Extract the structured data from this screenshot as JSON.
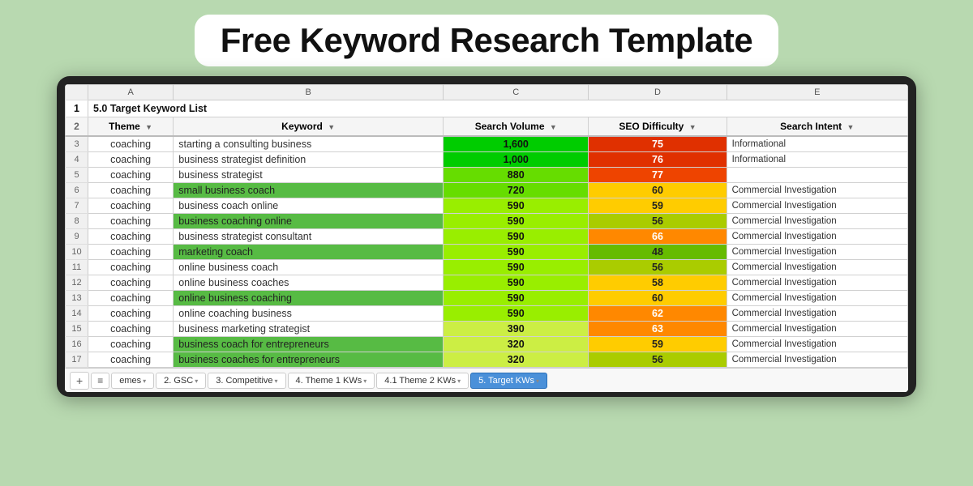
{
  "title": "Free Keyword Research Template",
  "spreadsheet": {
    "section_title": "5.0 Target Keyword List",
    "columns": {
      "letters": [
        "",
        "A",
        "B",
        "C",
        "D",
        "E"
      ],
      "headers": [
        "",
        "Theme",
        "Keyword",
        "Search Volume",
        "SEO Difficulty",
        "Search Intent"
      ]
    },
    "rows": [
      {
        "num": 3,
        "theme": "coaching",
        "keyword": "starting a consulting business",
        "keyword_green": false,
        "volume": "1,600",
        "vol_class": "green-bright",
        "seo": 75,
        "seo_class": "red-dark",
        "intent": "Informational"
      },
      {
        "num": 4,
        "theme": "coaching",
        "keyword": "business strategist definition",
        "keyword_green": false,
        "volume": "1,000",
        "vol_class": "green-bright",
        "seo": 76,
        "seo_class": "red-dark",
        "intent": "Informational"
      },
      {
        "num": 5,
        "theme": "coaching",
        "keyword": "business strategist",
        "keyword_green": false,
        "volume": "880",
        "vol_class": "green-med",
        "seo": 77,
        "seo_class": "red-med",
        "intent": ""
      },
      {
        "num": 6,
        "theme": "coaching",
        "keyword": "small business coach",
        "keyword_green": true,
        "volume": "720",
        "vol_class": "green-med",
        "seo": 60,
        "seo_class": "yellow",
        "intent": "Commercial Investigation"
      },
      {
        "num": 7,
        "theme": "coaching",
        "keyword": "business coach online",
        "keyword_green": false,
        "volume": "590",
        "vol_class": "green-light",
        "seo": 59,
        "seo_class": "yellow",
        "intent": "Commercial Investigation"
      },
      {
        "num": 8,
        "theme": "coaching",
        "keyword": "business coaching online",
        "keyword_green": true,
        "volume": "590",
        "vol_class": "green-light",
        "seo": 56,
        "seo_class": "yellow-green",
        "intent": "Commercial Investigation"
      },
      {
        "num": 9,
        "theme": "coaching",
        "keyword": "business strategist consultant",
        "keyword_green": false,
        "volume": "590",
        "vol_class": "green-light",
        "seo": 66,
        "seo_class": "orange",
        "intent": "Commercial Investigation"
      },
      {
        "num": 10,
        "theme": "coaching",
        "keyword": "marketing coach",
        "keyword_green": true,
        "volume": "590",
        "vol_class": "green-light",
        "seo": 48,
        "seo_class": "green",
        "intent": "Commercial Investigation"
      },
      {
        "num": 11,
        "theme": "coaching",
        "keyword": "online business coach",
        "keyword_green": false,
        "volume": "590",
        "vol_class": "green-light",
        "seo": 56,
        "seo_class": "yellow-green",
        "intent": "Commercial Investigation"
      },
      {
        "num": 12,
        "theme": "coaching",
        "keyword": "online business coaches",
        "keyword_green": false,
        "volume": "590",
        "vol_class": "green-light",
        "seo": 58,
        "seo_class": "yellow",
        "intent": "Commercial Investigation"
      },
      {
        "num": 13,
        "theme": "coaching",
        "keyword": "online business coaching",
        "keyword_green": true,
        "volume": "590",
        "vol_class": "green-light",
        "seo": 60,
        "seo_class": "yellow",
        "intent": "Commercial Investigation"
      },
      {
        "num": 14,
        "theme": "coaching",
        "keyword": "online coaching business",
        "keyword_green": false,
        "volume": "590",
        "vol_class": "green-light",
        "seo": 62,
        "seo_class": "orange",
        "intent": "Commercial Investigation"
      },
      {
        "num": 15,
        "theme": "coaching",
        "keyword": "business marketing strategist",
        "keyword_green": false,
        "volume": "390",
        "vol_class": "green-pale",
        "seo": 63,
        "seo_class": "orange",
        "intent": "Commercial Investigation"
      },
      {
        "num": 16,
        "theme": "coaching",
        "keyword": "business coach for entrepreneurs",
        "keyword_green": true,
        "volume": "320",
        "vol_class": "green-pale",
        "seo": 59,
        "seo_class": "yellow",
        "intent": "Commercial Investigation"
      },
      {
        "num": 17,
        "theme": "coaching",
        "keyword": "business coaches for entrepreneurs",
        "keyword_green": true,
        "volume": "320",
        "vol_class": "green-pale",
        "seo": 56,
        "seo_class": "yellow-green",
        "intent": "Commercial Investigation"
      }
    ]
  },
  "tabs": {
    "add_label": "+",
    "menu_label": "≡",
    "items": [
      {
        "label": "emes",
        "prefix": "",
        "suffix": "▾",
        "active": false
      },
      {
        "label": "2. GSC",
        "prefix": "",
        "suffix": "▾",
        "active": false
      },
      {
        "label": "3. Competitive",
        "prefix": "",
        "suffix": "▾",
        "active": false
      },
      {
        "label": "4. Theme 1 KWs",
        "prefix": "",
        "suffix": "▾",
        "active": false
      },
      {
        "label": "4.1 Theme 2 KWs",
        "prefix": "",
        "suffix": "▾",
        "active": false
      },
      {
        "label": "5. Target KWs",
        "prefix": "",
        "suffix": "▾",
        "active": true
      }
    ]
  }
}
